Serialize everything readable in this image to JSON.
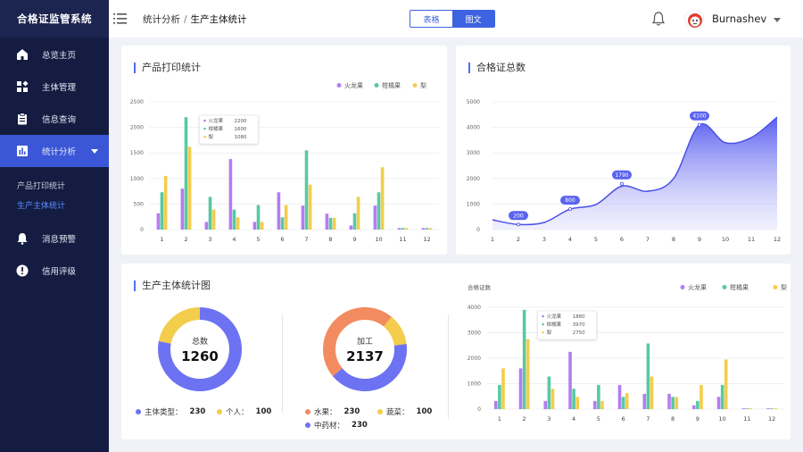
{
  "app": {
    "title": "合格证监管系统"
  },
  "sidebar": {
    "items": [
      {
        "label": "总览主页",
        "icon": "home-icon"
      },
      {
        "label": "主体管理",
        "icon": "grid-icon"
      },
      {
        "label": "信息查询",
        "icon": "clipboard-icon"
      },
      {
        "label": "统计分析",
        "icon": "bar-chart-icon"
      },
      {
        "label": "消息预警",
        "icon": "bell-icon"
      },
      {
        "label": "信用评级",
        "icon": "alert-icon"
      }
    ],
    "sub_items": [
      {
        "label": "产品打印统计"
      },
      {
        "label": "生产主体统计"
      }
    ]
  },
  "header": {
    "breadcrumb": [
      "统计分析",
      "生产主体统计"
    ],
    "separator": "/",
    "toggle": [
      "表格",
      "图文"
    ],
    "user": "Burnashev"
  },
  "colors": {
    "primary": "#3e63e0",
    "purple": "#b57cf0",
    "green": "#58c9a2",
    "yellow": "#f3cd4b",
    "orange": "#f28b5f",
    "indigo": "#6d72f2"
  },
  "print_stats": {
    "title": "产品打印统计",
    "chart_data": {
      "type": "bar",
      "categories": [
        "1",
        "2",
        "3",
        "4",
        "5",
        "6",
        "7",
        "8",
        "9",
        "10",
        "11",
        "12"
      ],
      "series": [
        {
          "name": "火龙果",
          "values": [
            320,
            800,
            150,
            1380,
            150,
            730,
            470,
            310,
            80,
            470,
            30,
            30
          ]
        },
        {
          "name": "柑橘果",
          "values": [
            730,
            2200,
            640,
            390,
            480,
            240,
            1550,
            230,
            320,
            730,
            30,
            30
          ]
        },
        {
          "name": "梨",
          "values": [
            1050,
            1620,
            390,
            240,
            150,
            480,
            880,
            230,
            640,
            1220,
            30,
            30
          ]
        }
      ],
      "ylim": [
        0,
        2500
      ],
      "yticks": [
        0,
        500,
        1000,
        1500,
        2000,
        2500
      ],
      "legend": "top-right",
      "tooltip": {
        "category": "2",
        "rows": [
          {
            "name": "火龙果",
            "value": "2200"
          },
          {
            "name": "柑橘果",
            "value": "1600"
          },
          {
            "name": "梨",
            "value": "1080"
          }
        ]
      }
    }
  },
  "cert_total": {
    "title": "合格证总数",
    "chart_data": {
      "type": "area",
      "x": [
        1,
        2,
        3,
        4,
        5,
        6,
        7,
        8,
        9,
        10,
        11,
        12
      ],
      "values": [
        380,
        200,
        280,
        800,
        980,
        1700,
        1500,
        2000,
        4100,
        3400,
        3600,
        4400
      ],
      "ylim": [
        0,
        5000
      ],
      "yticks": [
        0,
        1000,
        2000,
        3000,
        4000,
        5000
      ],
      "labels": [
        {
          "x": 2,
          "value": "200",
          "y": 200
        },
        {
          "x": 4,
          "value": "800",
          "y": 800
        },
        {
          "x": 6,
          "value": "1790",
          "y": 1790
        },
        {
          "x": 9,
          "value": "4100",
          "y": 4100
        }
      ]
    }
  },
  "entity_stats": {
    "title": "生产主体统计图",
    "donut1": {
      "center_label": "总数",
      "center_value": "1260",
      "segments": [
        {
          "name": "主体类型",
          "value": 230,
          "color": "#6d72f2",
          "fraction": 0.78
        },
        {
          "name": "个人",
          "value": 100,
          "color": "#f3cd4b",
          "fraction": 0.22
        }
      ]
    },
    "donut2": {
      "center_label": "加工",
      "center_value": "2137",
      "segments": [
        {
          "name": "水果",
          "value": 230,
          "color": "#f28b5f",
          "fraction": 0.47
        },
        {
          "name": "蔬菜",
          "value": 100,
          "color": "#f3cd4b",
          "fraction": 0.12
        },
        {
          "name": "中药材",
          "value": 230,
          "color": "#6d72f2",
          "fraction": 0.41
        }
      ]
    },
    "bar_chart": {
      "chart_data": {
        "type": "bar",
        "ylabel": "合格证数",
        "categories": [
          "1",
          "2",
          "3",
          "4",
          "5",
          "6",
          "7",
          "8",
          "9",
          "10",
          "11",
          "12"
        ],
        "series": [
          {
            "name": "火龙果",
            "values": [
              320,
              1600,
              320,
              2250,
              320,
              950,
              600,
              600,
              150,
              480,
              30,
              30
            ]
          },
          {
            "name": "柑橘果",
            "values": [
              950,
              3900,
              1280,
              800,
              950,
              480,
              2580,
              480,
              320,
              950,
              30,
              30
            ]
          },
          {
            "name": "梨",
            "values": [
              1600,
              2750,
              800,
              480,
              320,
              630,
              1280,
              480,
              950,
              1950,
              30,
              30
            ]
          }
        ],
        "ylim": [
          0,
          4000
        ],
        "yticks": [
          0,
          1000,
          2000,
          3000,
          4000
        ],
        "legend": "top-right",
        "tooltip": {
          "category": "2",
          "rows": [
            {
              "name": "火龙果",
              "value": "1880"
            },
            {
              "name": "柑橘果",
              "value": "3970"
            },
            {
              "name": "梨",
              "value": "2750"
            }
          ]
        }
      }
    }
  }
}
